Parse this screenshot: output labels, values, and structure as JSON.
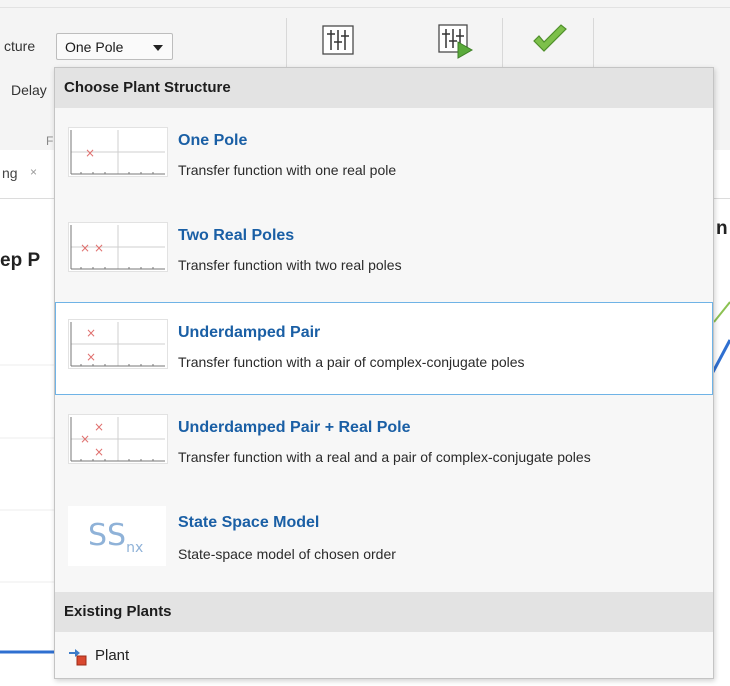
{
  "toolstrip": {
    "structure_label": "cture",
    "delay_label": "Delay",
    "group_label": "F",
    "plant_combo_value": "One Pole",
    "buttons": [
      {
        "icon": "parameter-sliders-icon"
      },
      {
        "icon": "parameter-sliders-run-icon"
      },
      {
        "icon": "apply-check-icon"
      }
    ]
  },
  "background": {
    "tab_label": "ng",
    "tab_close": "×",
    "left_heading_fragment": "ep P",
    "right_heading_fragment": "n"
  },
  "dropdown": {
    "header": "Choose Plant Structure",
    "items": [
      {
        "title": "One Pole",
        "description": "Transfer function with one real pole",
        "icon": "one-pole-pzmap-icon"
      },
      {
        "title": "Two Real Poles",
        "description": "Transfer function with two real poles",
        "icon": "two-real-poles-pzmap-icon"
      },
      {
        "title": "Underdamped Pair",
        "description": "Transfer function with a pair of complex-conjugate poles",
        "icon": "underdamped-pair-pzmap-icon",
        "selected": true
      },
      {
        "title": "Underdamped Pair + Real Pole",
        "description": "Transfer function with a real and a pair of complex-conjugate poles",
        "icon": "underdamped-pair-real-pole-pzmap-icon"
      },
      {
        "title": "State Space Model",
        "description": "State-space model of chosen order",
        "icon": "state-space-icon",
        "icon_text": "SS",
        "icon_subscript": "nx"
      }
    ],
    "existing_header": "Existing Plants",
    "existing": [
      {
        "label": "Plant",
        "icon": "plant-icon"
      }
    ]
  },
  "colors": {
    "title_blue": "#1a5fa5",
    "selected_border": "#6fb3e6",
    "pole_marker": "#e0706e",
    "plot_blue": "#2f6fd0",
    "plot_green": "#8cc152"
  }
}
